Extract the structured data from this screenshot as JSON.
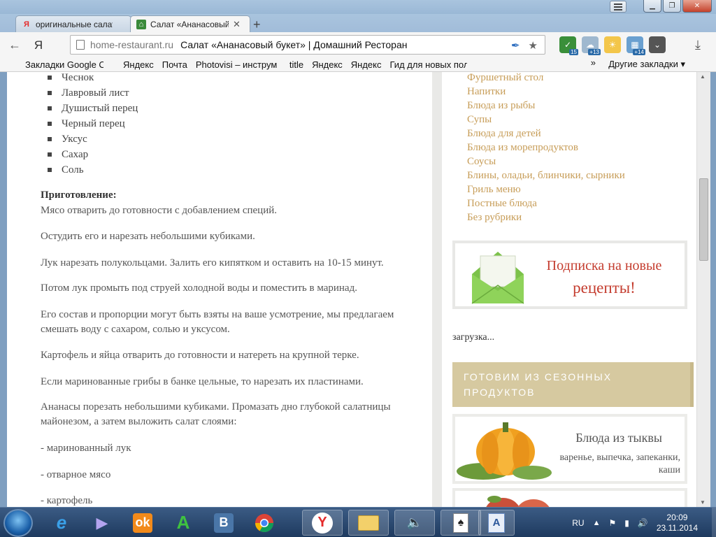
{
  "browser": {
    "tabs": [
      {
        "title": "оригинальные салаты",
        "favicon": "yandex-icon"
      },
      {
        "title": "Салат «Ананасовый букет»",
        "favicon": "home-restaurant-icon"
      }
    ],
    "omnibox": {
      "domain": "home-restaurant.ru",
      "page_title": "Салат «Ананасовый букет» | Домашний Ресторан"
    },
    "yandex_label": "Я",
    "extensions": [
      {
        "name": "adblock-shield-icon",
        "badge": "15"
      },
      {
        "name": "weather-cloud-icon",
        "badge": "+13"
      },
      {
        "name": "sun-icon",
        "badge": ""
      },
      {
        "name": "calendar-icon",
        "badge": "+14"
      },
      {
        "name": "pocket-icon",
        "badge": ""
      }
    ],
    "bookmarks": [
      "Закладки Google Ch",
      "Яндекс",
      "Почта",
      "Photovisi – инструм",
      "title",
      "Яндекс",
      "Яндекс",
      "Гид для новых поль"
    ],
    "chevron": "»",
    "other_bookmarks": "Другие закладки ▾"
  },
  "article": {
    "ingredients": [
      "Чеснок",
      "Лавровый лист",
      "Душистый перец",
      "Черный перец",
      "Уксус",
      "Сахар",
      "Соль"
    ],
    "prep_heading": "Приготовление:",
    "paragraphs": [
      "Мясо отварить до готовности с добавлением специй.",
      "Остудить его и нарезать небольшими кубиками.",
      "Лук нарезать полукольцами. Залить его кипятком и оставить на 10-15 минут.",
      "Потом лук промыть под струей холодной воды и поместить в маринад.",
      "Его состав и пропорции могут быть взяты на ваше усмотрение, мы предлагаем смешать воду с сахаром, солью и уксусом.",
      "Картофель и яйца отварить до готовности и натереть на крупной терке.",
      "Если маринованные грибы в банке цельные, то нарезать их пластинами.",
      "Ананасы порезать небольшими кубиками. Промазать дно глубокой салатницы майонезом, а затем выложить салат слоями:",
      "- маринованный лук",
      "- отварное мясо",
      "- картофель"
    ]
  },
  "sidebar": {
    "categories": [
      "Фуршетный стол",
      "Напитки",
      "Блюда из рыбы",
      "Супы",
      "Блюда для детей",
      "Блюда из морепродуктов",
      "Соусы",
      "Блины, оладьи, блинчики, сырники",
      "Гриль меню",
      "Постные блюда",
      "Без рубрики"
    ],
    "subscribe_line1": "Подписка на новые",
    "subscribe_line2": "рецепты!",
    "loading": "загрузка...",
    "seasonal_header": "ГОТОВИМ ИЗ СЕЗОННЫХ ПРОДУКТОВ",
    "pumpkin_title": "Блюда из тыквы",
    "pumpkin_sub": "варенье, выпечка, запеканки, каши"
  },
  "taskbar": {
    "language": "RU",
    "time": "20:09",
    "date": "23.11.2014",
    "apps": [
      "internet-explorer-icon",
      "media-player-icon",
      "odnoklassniki-icon",
      "green-a-icon",
      "vk-icon",
      "chrome-icon",
      "yandex-browser-icon",
      "file-explorer-icon",
      "volume-app-icon",
      "solitaire-icon",
      "word-icon"
    ]
  },
  "colors": {
    "link": "#c79d58",
    "subscribe_red": "#c43c2e",
    "seasonal_bg": "#d6c9a0"
  }
}
